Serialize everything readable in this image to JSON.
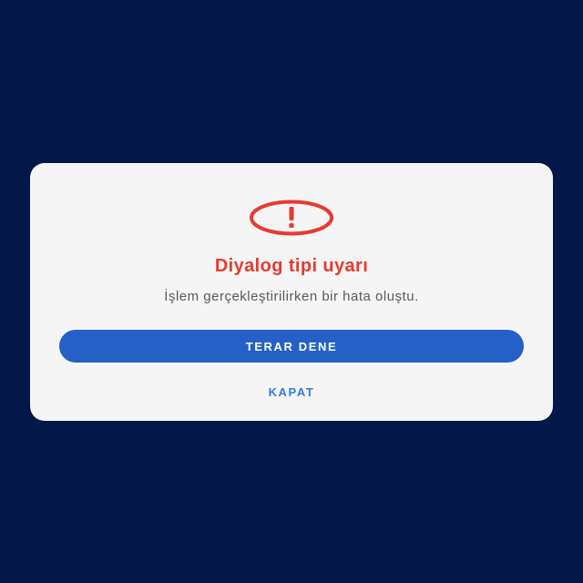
{
  "dialog": {
    "icon": "exclamation-circle-icon",
    "title": "Diyalog tipi uyarı",
    "message": "İşlem gerçekleştirilirken bir hata oluştu.",
    "primary_button_label": "TERAR DENE",
    "secondary_button_label": "KAPAT"
  },
  "colors": {
    "background": "#031748",
    "dialog_background": "#f5f5f5",
    "title": "#e83a30",
    "icon": "#e83a30",
    "message": "#5b5b5b",
    "primary_button": "#2460c8",
    "primary_button_text": "#ffffff",
    "secondary_button_text": "#2f7fe0"
  }
}
